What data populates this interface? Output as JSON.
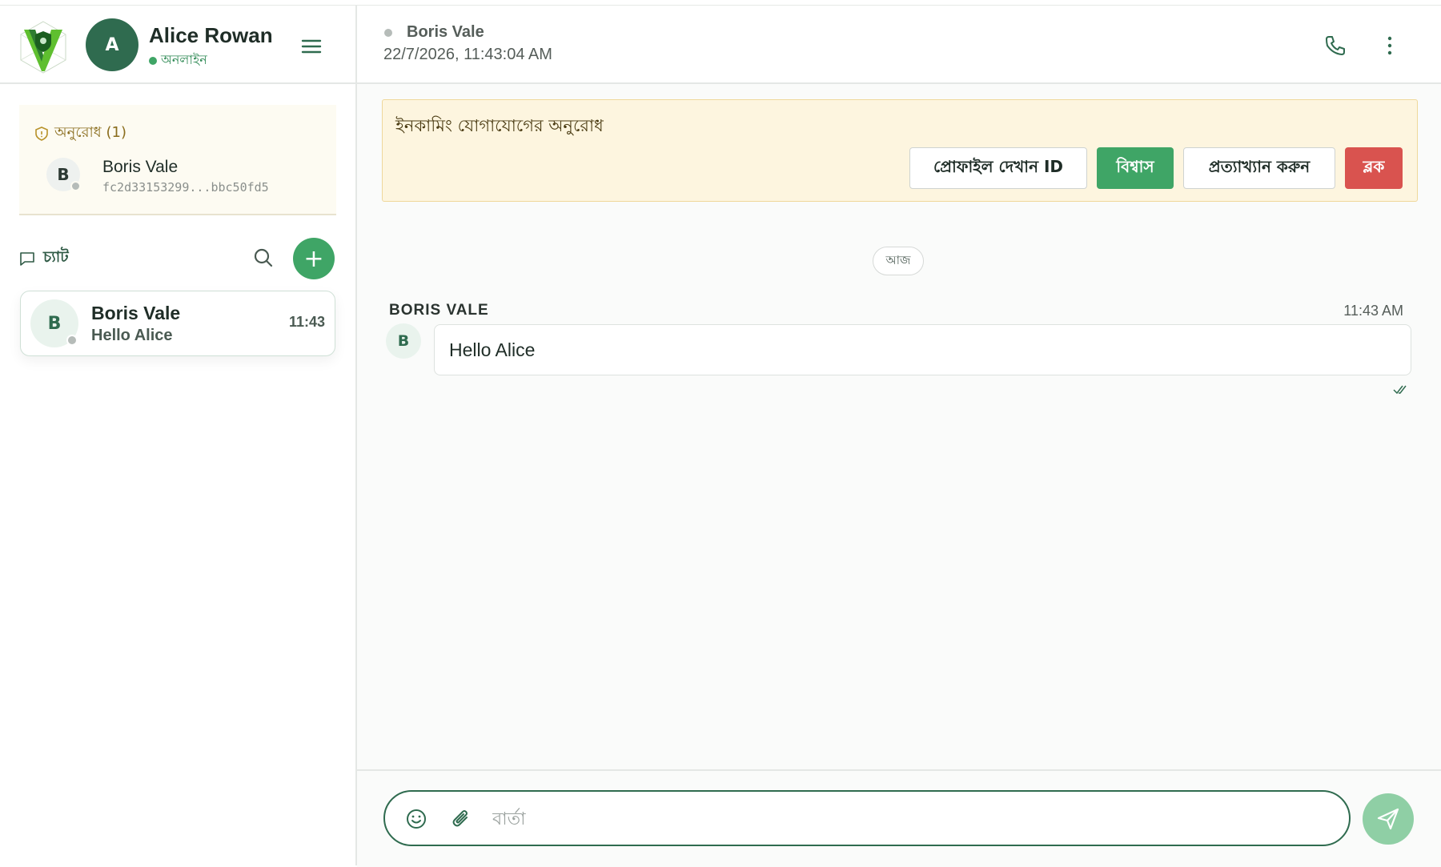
{
  "user": {
    "name": "Alice Rowan",
    "avatar_letter": "A",
    "status": "অনলাইন"
  },
  "requests": {
    "title": "অনুরোধ (1)",
    "items": [
      {
        "name": "Boris Vale",
        "avatar_letter": "B",
        "id": "fc2d33153299...bbc50fd5"
      }
    ]
  },
  "chats": {
    "label": "চ্যাট",
    "add_label": "+",
    "items": [
      {
        "name": "Boris Vale",
        "avatar_letter": "B",
        "last_message": "Hello Alice",
        "time": "11:43"
      }
    ]
  },
  "conversation": {
    "contact_name": "Boris Vale",
    "timestamp": "22/7/2026, 11:43:04 AM",
    "banner": {
      "title": "ইনকামিং যোগাযোগের অনুরোধ",
      "view_profile": "প্রোফাইল দেখান ID",
      "trust": "বিশ্বাস",
      "decline": "প্রত্যাখ্যান করুন",
      "block": "ব্লক"
    },
    "day_label": "আজ",
    "messages": [
      {
        "sender": "BORIS VALE",
        "avatar_letter": "B",
        "time": "11:43 AM",
        "text": "Hello Alice"
      }
    ]
  },
  "composer": {
    "placeholder": "বার্তা",
    "value": ""
  },
  "colors": {
    "primary": "#2f6b4f",
    "accent": "#3fa566",
    "danger": "#d9534f",
    "banner_bg": "#fdf5df"
  },
  "icons": [
    "logo-icon",
    "menu-icon",
    "shield-icon",
    "chat-icon",
    "search-icon",
    "plus-icon",
    "phone-icon",
    "more-vertical-icon",
    "double-check-icon",
    "emoji-icon",
    "paperclip-icon",
    "send-icon"
  ]
}
